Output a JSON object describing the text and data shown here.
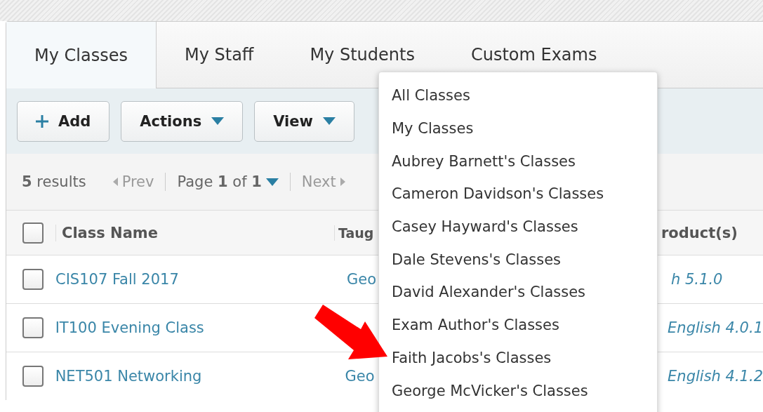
{
  "tabs": [
    {
      "label": "My Classes",
      "selected": true
    },
    {
      "label": "My Staff",
      "selected": false
    },
    {
      "label": "My Students",
      "selected": false
    },
    {
      "label": "Custom Exams",
      "selected": false
    }
  ],
  "toolbar": {
    "buttons": [
      {
        "label": "Add",
        "kind": "add"
      },
      {
        "label": "Actions",
        "kind": "menu"
      },
      {
        "label": "View",
        "kind": "menu"
      }
    ]
  },
  "pager": {
    "results": "**5** results",
    "prev": "Prev",
    "page": "Page **1** of **1**",
    "next": "Next"
  },
  "table": {
    "header_checked": false,
    "columns": [
      "Class Name",
      "Taug",
      "roduct(s)"
    ],
    "rows": [
      {
        "checked": false,
        "class_name": "CIS107 Fall 2017",
        "teacher": "Geo",
        "product": "h 5.1.0"
      },
      {
        "checked": false,
        "class_name": "IT100 Evening Class",
        "product": "English 4.0.1"
      },
      {
        "checked": false,
        "class_name": "NET501 Networking",
        "teacher": "Geo",
        "product": "English 4.1.2"
      }
    ]
  },
  "dropdown": {
    "items": [
      "All Classes",
      "My Classes",
      "Aubrey Barnett's Classes",
      "Cameron Davidson's Classes",
      "Casey Hayward's Classes",
      "Dale Stevens's Classes",
      "David Alexander's Classes",
      "Exam Author's Classes",
      "Faith Jacobs's Classes",
      "George McVicker's Classes"
    ]
  }
}
